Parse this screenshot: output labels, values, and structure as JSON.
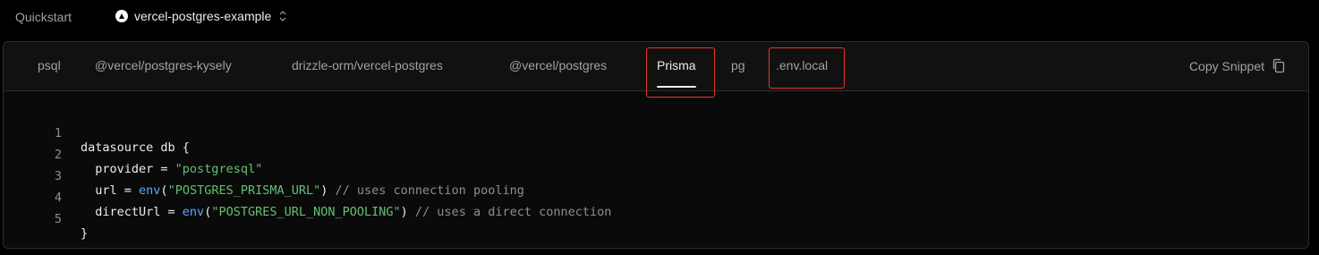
{
  "header": {
    "label": "Quickstart",
    "project": "vercel-postgres-example"
  },
  "tabs": [
    {
      "label": "psql"
    },
    {
      "label": "@vercel/postgres-kysely"
    },
    {
      "label": "drizzle-orm/vercel-postgres"
    },
    {
      "label": "@vercel/postgres"
    },
    {
      "label": "Prisma"
    },
    {
      "label": "pg"
    },
    {
      "label": ".env.local"
    }
  ],
  "active_tab": "Prisma",
  "copy_label": "Copy Snippet",
  "code": {
    "line_numbers": [
      "1",
      "2",
      "3",
      "4",
      "5"
    ],
    "l1": "datasource db {",
    "l2_a": "  provider = ",
    "l2_str": "\"postgresql\"",
    "l3_a": "  url = ",
    "l3_fn": "env",
    "l3_p1": "(",
    "l3_str": "\"POSTGRES_PRISMA_URL\"",
    "l3_p2": ") ",
    "l3_cm": "// uses connection pooling",
    "l4_a": "  directUrl = ",
    "l4_fn": "env",
    "l4_p1": "(",
    "l4_str": "\"POSTGRES_URL_NON_POOLING\"",
    "l4_p2": ") ",
    "l4_cm": "// uses a direct connection",
    "l5": "}"
  },
  "colors": {
    "string": "#62c073",
    "function": "#5aa7ff",
    "comment": "#8f8f8f",
    "highlight": "#e5342f"
  }
}
